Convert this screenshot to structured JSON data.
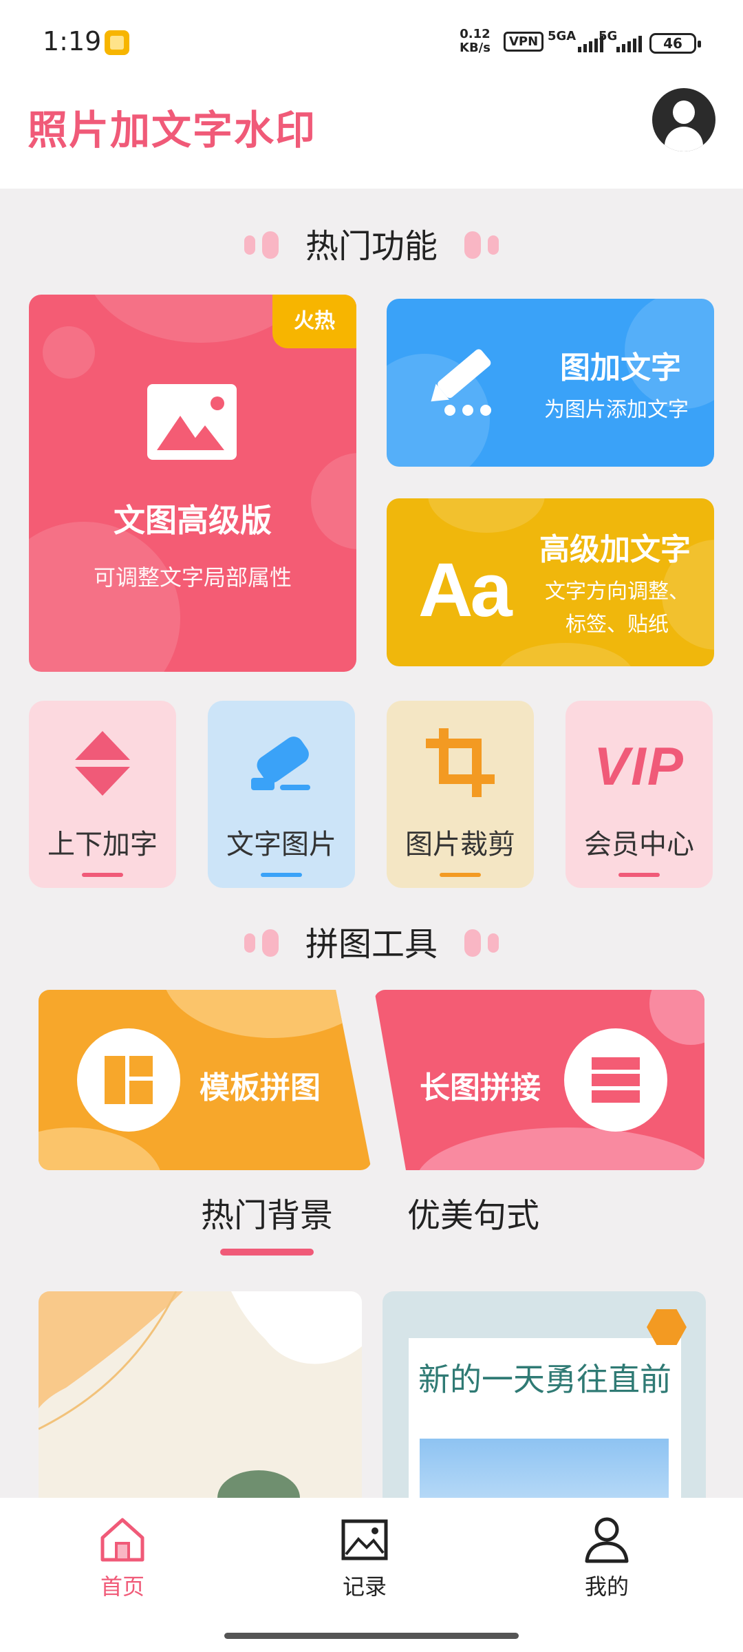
{
  "status_bar": {
    "time": "1:19",
    "speed_value": "0.12",
    "speed_unit": "KB/s",
    "vpn": "VPN",
    "net1": "5GA",
    "net2": "5G",
    "battery": "46"
  },
  "header": {
    "app_title": "照片加文字水印",
    "avatar_icon": "user-avatar-icon"
  },
  "hot_section": {
    "title": "热门功能",
    "main_card": {
      "badge": "火热",
      "title": "文图高级版",
      "subtitle": "可调整文字局部属性",
      "color": "#f45c74"
    },
    "card_add_text": {
      "title": "图加文字",
      "subtitle": "为图片添加文字",
      "color": "#3aa2f8"
    },
    "card_advanced_text": {
      "icon_text": "Aa",
      "title": "高级加文字",
      "subtitle_line1": "文字方向调整、",
      "subtitle_line2": "标签、贴纸",
      "color": "#f0b70c"
    }
  },
  "tiles": [
    {
      "label": "上下加字",
      "icon": "up-down-arrows-icon",
      "bg": "#fcd9df",
      "accent": "#f05a78"
    },
    {
      "label": "文字图片",
      "icon": "highlighter-icon",
      "bg": "#cce4f8",
      "accent": "#3aa2f8"
    },
    {
      "label": "图片裁剪",
      "icon": "crop-icon",
      "bg": "#f4e6c4",
      "accent": "#f39a22"
    },
    {
      "label": "会员中心",
      "icon_text": "VIP",
      "bg": "#fcd9df",
      "accent": "#f05a78"
    }
  ],
  "collage_section": {
    "title": "拼图工具",
    "template": {
      "label": "模板拼图",
      "icon": "grid-layout-icon"
    },
    "long_image": {
      "label": "长图拼接",
      "icon": "stacked-rows-icon"
    }
  },
  "tabs": {
    "active": "热门背景",
    "inactive": "优美句式"
  },
  "previews": {
    "card2_text": "新的一天勇往直前"
  },
  "bottom_nav": {
    "home": "首页",
    "records": "记录",
    "mine": "我的",
    "active_color": "#f05a78"
  }
}
